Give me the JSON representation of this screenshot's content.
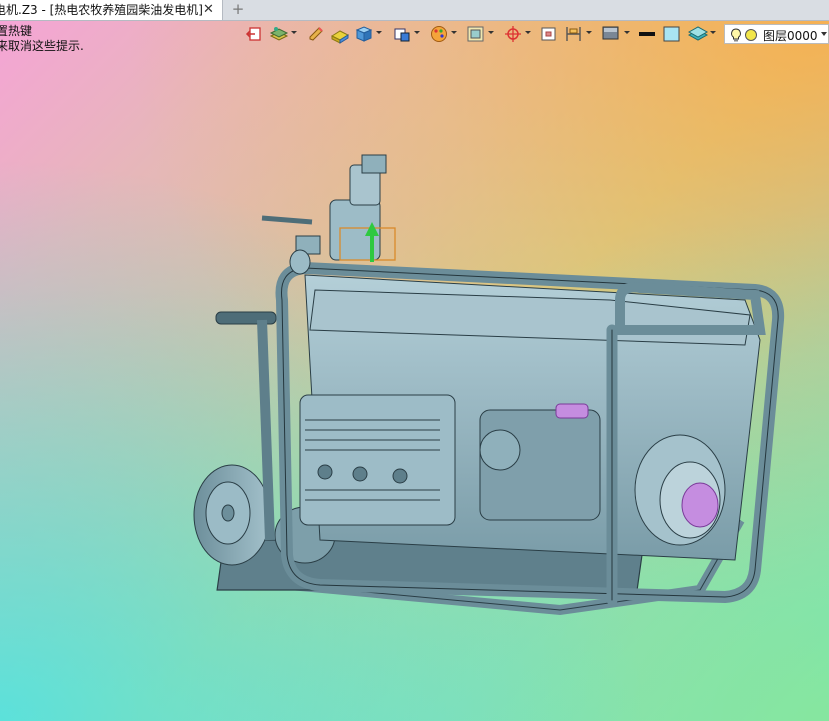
{
  "tab": {
    "title": "电机.Z3 - [热电农牧养殖园柴油发电机]",
    "close": "✕",
    "new": "+"
  },
  "hints": {
    "line1": "置热键",
    "line2": "来取消这些提示."
  },
  "toolbar": {
    "icons": [
      "exit-icon",
      "layers-stack-icon",
      "pencil-icon",
      "eraser-icon",
      "cube-icon",
      "view-cube-icon",
      "palette-icon",
      "frame-icon",
      "crosshair-icon",
      "box-icon",
      "dimension-icon",
      "display-icon",
      "line-style-icon",
      "color-icon",
      "layer-icon"
    ],
    "layer_select": {
      "value": "图层0000",
      "icons": [
        "lightbulb-icon",
        "layer-color-dot-icon"
      ]
    }
  },
  "colors": {
    "metal": "#8fb3bf",
    "metal_dark": "#5e7f8b",
    "highlight": "#c58de0",
    "axis_green": "#2ec940",
    "pivot_orange": "#d98a2b"
  }
}
